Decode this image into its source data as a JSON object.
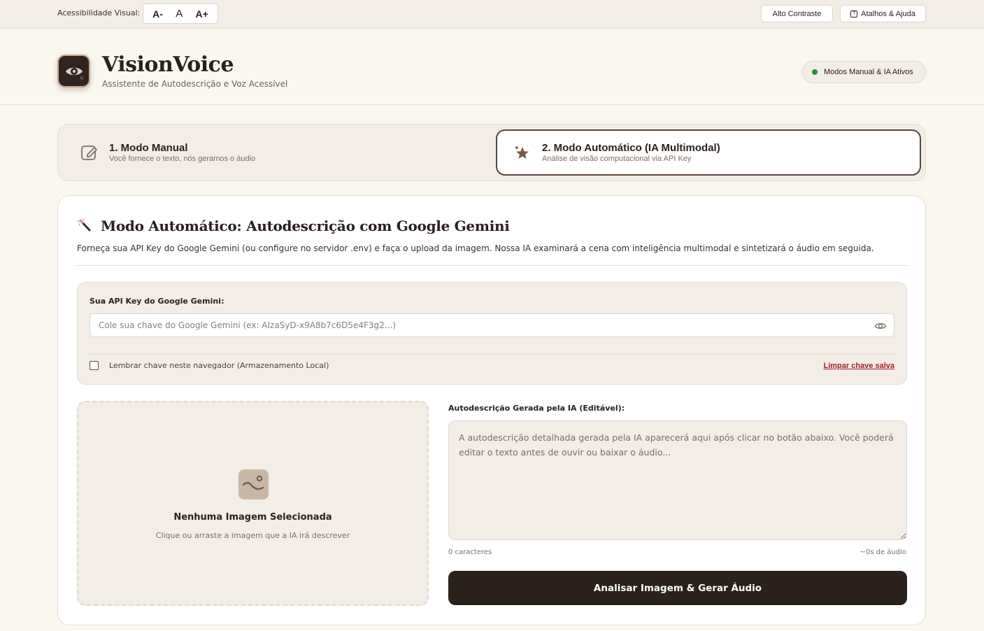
{
  "topbar": {
    "a11y_label": "Acessibilidade Visual:",
    "font_decrease": "A-",
    "font_reset": "A",
    "font_increase": "A+",
    "contrast_button": "Alto Contraste",
    "help_button": "Atalhos & Ajuda"
  },
  "header": {
    "brand": "VisionVoice",
    "tagline": "Assistente de Autodescrição e Voz Acessível",
    "status": "Modos Manual & IA Ativos",
    "status_color": "#2f8a3e"
  },
  "modes": {
    "manual": {
      "title": "1. Modo Manual",
      "subtitle": "Você fornece o texto, nós geramos o áudio",
      "icon": "edit-icon"
    },
    "auto": {
      "title": "2. Modo Automático (IA Multimodal)",
      "subtitle": "Análise de visão computacional via API Key",
      "icon": "sparkle-icon",
      "active": true
    }
  },
  "card": {
    "title": "Modo Automático: Autodescrição com Google Gemini",
    "description": "Forneça sua API Key do Google Gemini (ou configure no servidor .env) e faça o upload da imagem. Nossa IA examinará a cena com inteligência multimodal e sintetizará o áudio em seguida.",
    "title_icon": "magic-wand-icon"
  },
  "api": {
    "label": "Sua API Key do Google Gemini:",
    "placeholder": "Cole sua chave do Google Gemini (ex: AIzaSyD-x9A8b7c6D5e4F3g2...)",
    "value": "",
    "remember_label": "Lembrar chave neste navegador (Armazenamento Local)",
    "remember_checked": false,
    "clear_link": "Limpar chave salva"
  },
  "dropzone": {
    "title": "Nenhuma Imagem Selecionada",
    "subtitle": "Clique ou arraste a imagem que a IA irá descrever"
  },
  "description": {
    "label": "Autodescrição Gerada pela IA (Editável):",
    "placeholder": "A autodescrição detalhada gerada pela IA aparecerá aqui após clicar no botão abaixo. Você poderá editar o texto antes de ouvir ou baixar o áudio...",
    "value": "",
    "char_count": "0 caracteres",
    "audio_estimate": "~0s de áudio"
  },
  "actions": {
    "analyze_button": "Analisar Imagem & Gerar Áudio"
  },
  "colors": {
    "background": "#faf7f1",
    "panel": "#f2ede6",
    "dark": "#2a211d",
    "danger_link": "#a3222a"
  }
}
